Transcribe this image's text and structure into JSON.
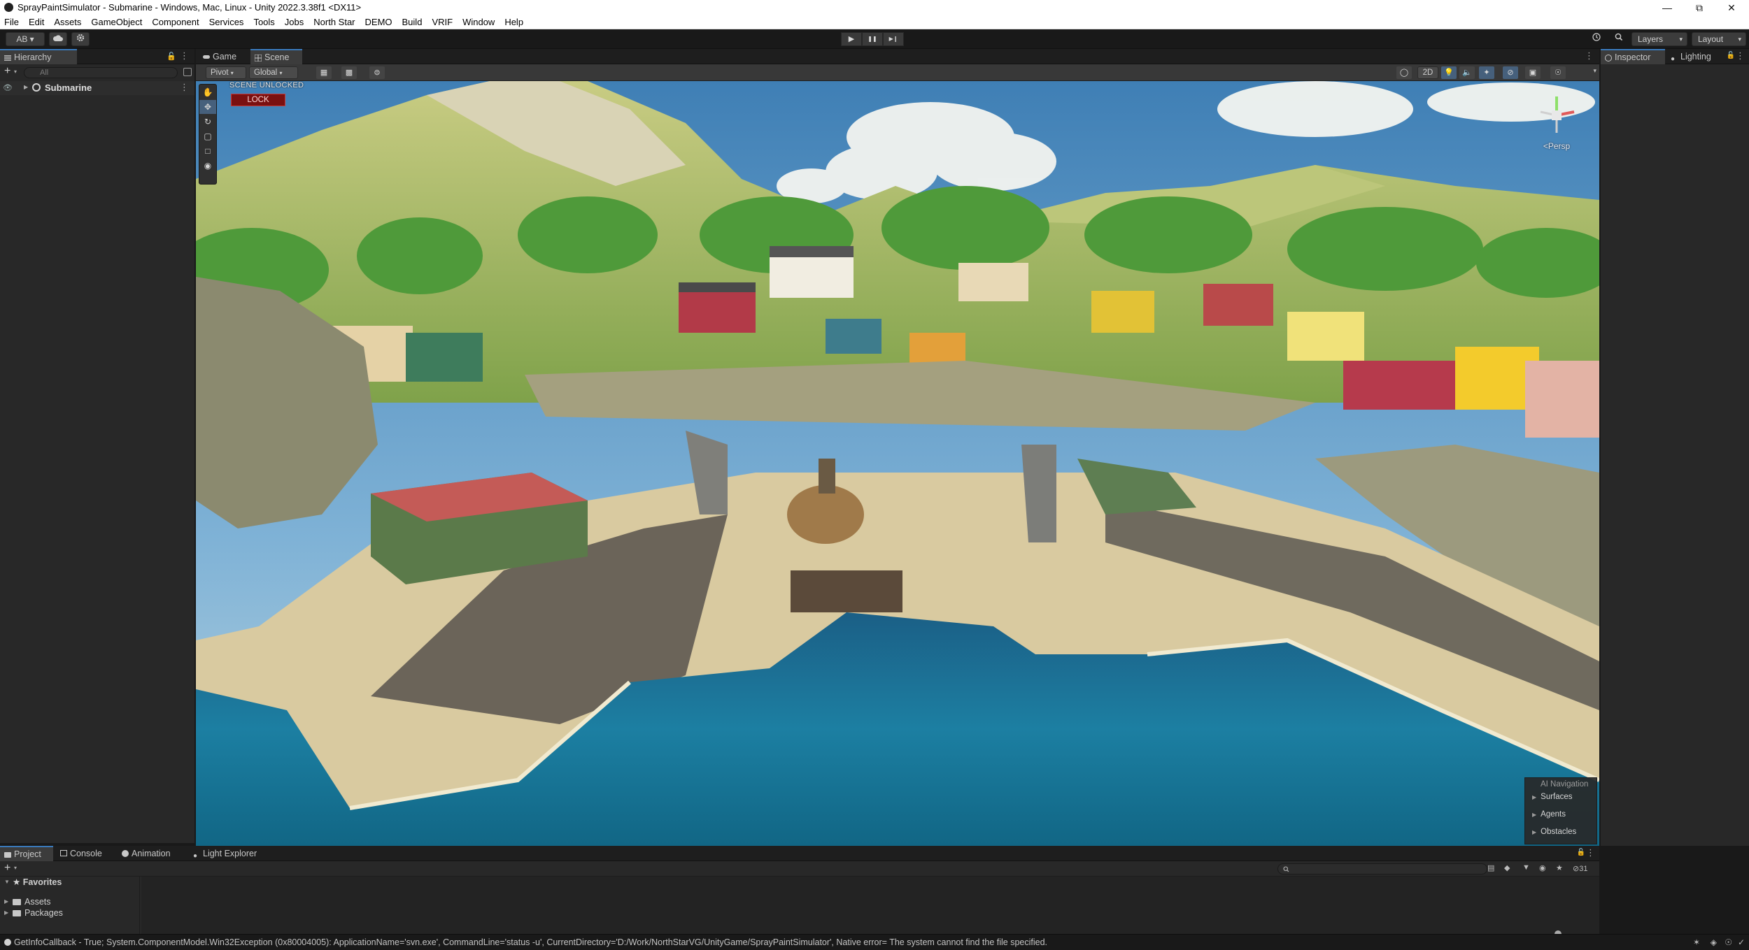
{
  "window": {
    "title": "SprayPaintSimulator - Submarine - Windows, Mac, Linux - Unity 2022.3.38f1 <DX11>",
    "controls": {
      "minimize": "—",
      "restore": "⧉",
      "close": "✕"
    }
  },
  "menu": [
    "File",
    "Edit",
    "Assets",
    "GameObject",
    "Component",
    "Services",
    "Tools",
    "Jobs",
    "North Star",
    "DEMO",
    "Build",
    "VRIF",
    "Window",
    "Help"
  ],
  "toolbar": {
    "account": "AB ▾",
    "cloud_icon": "cloud-icon",
    "settings_icon": "gear-icon",
    "play": "▶",
    "pause": "❚❚",
    "step": "▶❙",
    "layers": "Layers",
    "layout": "Layout"
  },
  "hierarchy": {
    "tab": "Hierarchy",
    "search_placeholder": "All",
    "root": "Submarine"
  },
  "scene_view": {
    "tabs": [
      "Game",
      "Scene"
    ],
    "active_tab": "Scene",
    "pivot": "Pivot",
    "global": "Global",
    "mode_2d": "2D",
    "scene_status": "SCENE UNLOCKED",
    "lock_button": "LOCK",
    "camera": "<Persp",
    "ai_navigation": {
      "title": "AI Navigation",
      "items": [
        "Surfaces",
        "Agents",
        "Obstacles"
      ]
    }
  },
  "inspector": {
    "tabs": [
      "Inspector",
      "Lighting"
    ]
  },
  "bottom": {
    "tabs": [
      "Project",
      "Console",
      "Animation",
      "Light Explorer"
    ],
    "active_tab": "Project",
    "favorites": "Favorites",
    "tree": [
      "Assets",
      "Packages"
    ],
    "hidden_count": "31"
  },
  "status": {
    "message": "GetInfoCallback - True; System.ComponentModel.Win32Exception (0x80004005): ApplicationName='svn.exe', CommandLine='status -u', CurrentDirectory='D:/Work/NorthStarVG/UnityGame/SprayPaintSimulator', Native error= The system cannot find the file specified."
  },
  "colors": {
    "accent": "#3a79bb",
    "lock_red": "#7a1010",
    "water": "#1f7a9b",
    "sky": "#5e9cc9"
  }
}
